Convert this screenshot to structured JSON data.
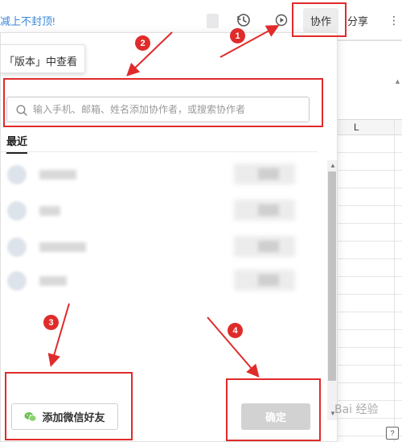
{
  "toolbar": {
    "notice_text": "减上不封顶!",
    "collab_label": "协作",
    "share_label": "分享",
    "more_label": "⋮",
    "icons": [
      "file-icon",
      "history-icon",
      "present-icon"
    ]
  },
  "hint": {
    "text": "「版本」中查看"
  },
  "panel": {
    "search": {
      "placeholder": "输入手机、邮箱、姓名添加协作者，或搜索协作者"
    },
    "tab_recent": "最近",
    "contacts": [
      {
        "name": "████████",
        "blurred": true
      },
      {
        "name": "████",
        "blurred": true
      },
      {
        "name": "██████████",
        "blurred": true
      },
      {
        "name": "██████",
        "blurred": true
      }
    ],
    "wechat_button_label": "添加微信好友",
    "confirm_button_label": "确定"
  },
  "sheet": {
    "column_label": "L"
  },
  "annotations": {
    "steps": [
      "1",
      "2",
      "3",
      "4"
    ],
    "color": "#e02b2b"
  },
  "watermark": {
    "text": "Bai 经验",
    "corner_icon": "?"
  },
  "colors": {
    "accent_blue": "#3a87d6",
    "annotation_red": "#e02b2b",
    "confirm_disabled": "#d2d2d2"
  }
}
